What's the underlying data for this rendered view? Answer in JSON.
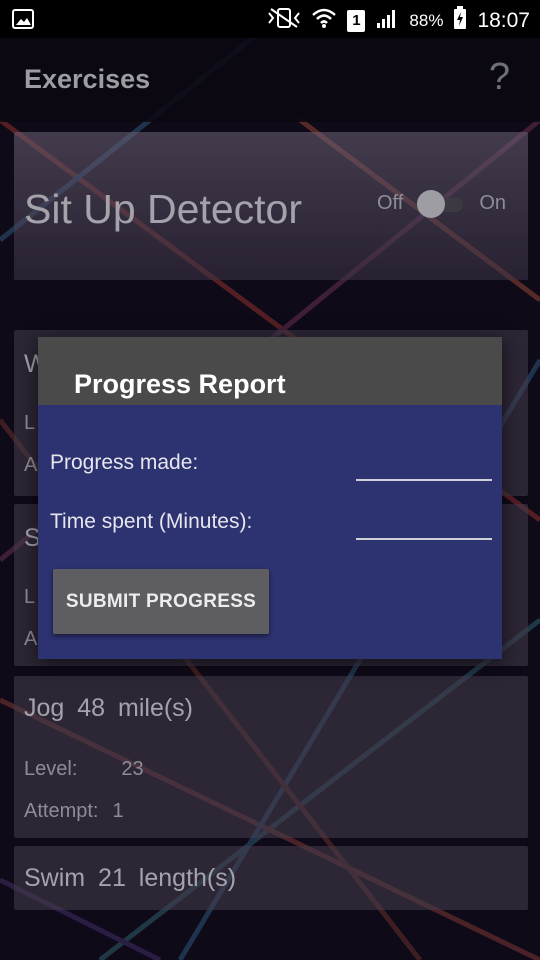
{
  "status_bar": {
    "battery": "88%",
    "sim_slot": "1",
    "time": "18:07",
    "icons": [
      "image-icon",
      "mute-vibrate-icon",
      "wifi-icon",
      "signal-icon",
      "battery-charging-icon"
    ]
  },
  "app_bar": {
    "title": "Exercises",
    "help_glyph": "?"
  },
  "detector_card": {
    "title": "Sit Up Detector",
    "toggle_off_label": "Off",
    "toggle_on_label": "On",
    "toggle_state": "off"
  },
  "exercise_cards": [
    {
      "title_fragment": "W",
      "row1_fragment": "L",
      "row2_fragment": "A"
    },
    {
      "title_fragment": "S",
      "row1_fragment": "L",
      "row2_fragment": "A"
    },
    {
      "title": "Jog  48  mile(s)",
      "level_label": "Level:",
      "level_value": "23",
      "attempt_label": "Attempt:",
      "attempt_value": "1"
    },
    {
      "title": "Swim  21  length(s)"
    }
  ],
  "dialog": {
    "title": "Progress Report",
    "progress_label": "Progress made:",
    "progress_value": "",
    "time_label": "Time spent (Minutes):",
    "time_value": "",
    "submit_label": "SUBMIT PROGRESS"
  },
  "colors": {
    "dialog_header": "#4a4a4a",
    "dialog_body": "#2d3270",
    "button": "#5e5d61",
    "background": "#0e0a17"
  }
}
